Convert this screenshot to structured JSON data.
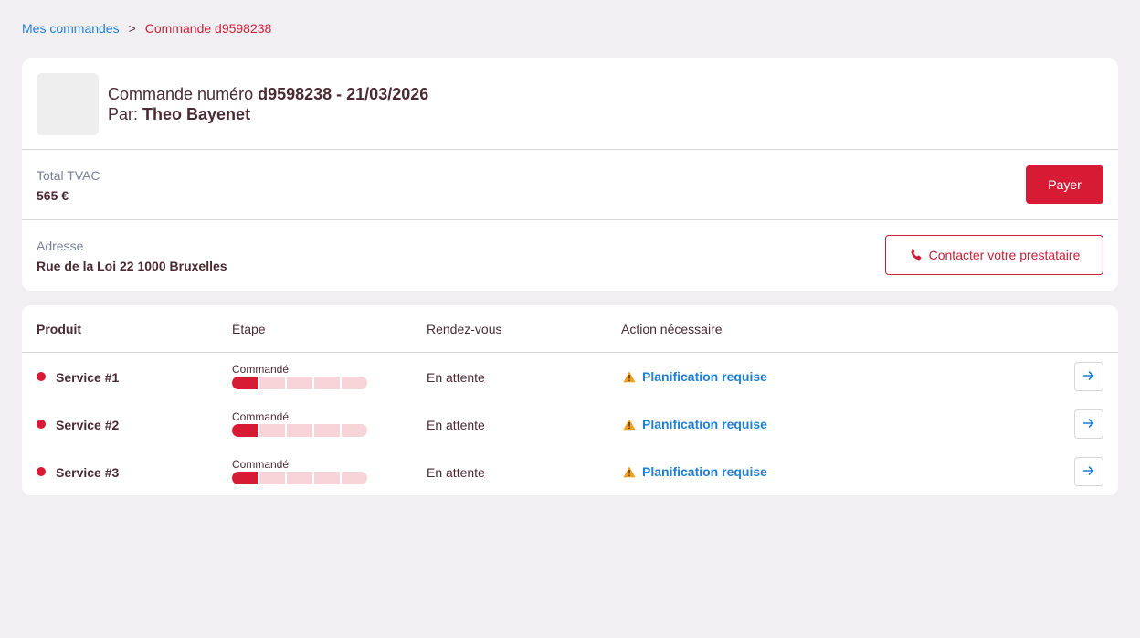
{
  "breadcrumb": {
    "parent": "Mes commandes",
    "separator": ">",
    "current": "Commande d9598238"
  },
  "order": {
    "number_prefix": "Commande numéro",
    "number_value": "d9598238 - 21/03/2026",
    "by_prefix": "Par:",
    "by_value": "Theo Bayenet",
    "total_label": "Total TVAC",
    "total_value": "565 €",
    "pay_label": "Payer",
    "address_label": "Adresse",
    "address_value": "Rue de la Loi 22 1000 Bruxelles",
    "contact_label": "Contacter votre prestataire",
    "contact_icon": "phone-icon"
  },
  "table": {
    "headers": {
      "product": "Produit",
      "stage": "Étape",
      "appointment": "Rendez-vous",
      "action": "Action nécessaire"
    },
    "rows": [
      {
        "name": "Service #1",
        "stage": "Commandé",
        "progress_steps_done": 1,
        "progress_steps_total": 5,
        "appointment": "En attente",
        "action": "Planification requise",
        "action_icon": "warning-icon",
        "open_icon": "arrow-right-icon"
      },
      {
        "name": "Service #2",
        "stage": "Commandé",
        "progress_steps_done": 1,
        "progress_steps_total": 5,
        "appointment": "En attente",
        "action": "Planification requise",
        "action_icon": "warning-icon",
        "open_icon": "arrow-right-icon"
      },
      {
        "name": "Service #3",
        "stage": "Commandé",
        "progress_steps_done": 1,
        "progress_steps_total": 5,
        "appointment": "En attente",
        "action": "Planification requise",
        "action_icon": "warning-icon",
        "open_icon": "arrow-right-icon"
      }
    ]
  },
  "colors": {
    "accent": "#d81b35",
    "link": "#1e7fd4",
    "text": "#4a2a33",
    "muted": "#7b7f96",
    "background": "#f1eff2",
    "progress_empty": "#f6d4d8",
    "warning": "#f0a020"
  }
}
